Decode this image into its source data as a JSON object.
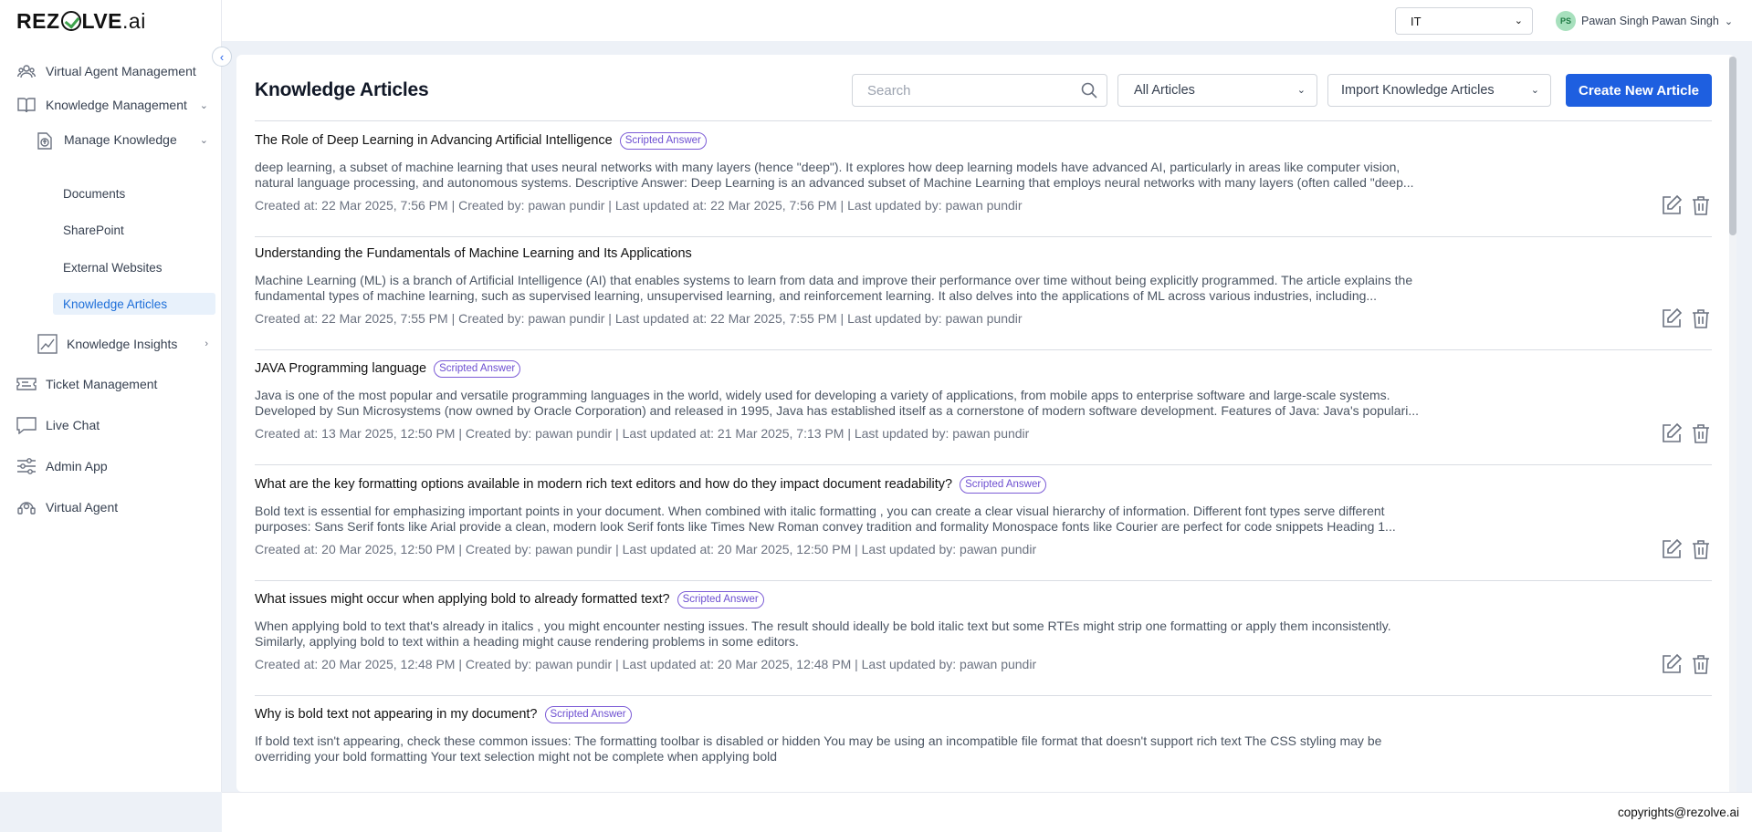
{
  "brand": {
    "logo_main": "REZ",
    "logo_rest": "LVE",
    "logo_suffix": ".ai"
  },
  "sidebar": {
    "items": [
      {
        "label": "Virtual Agent Management",
        "icon": "users-icon"
      },
      {
        "label": "Knowledge Management",
        "icon": "book-icon"
      },
      {
        "label": "Manage Knowledge",
        "icon": "doc-upload-icon"
      },
      {
        "label": "Documents"
      },
      {
        "label": "SharePoint"
      },
      {
        "label": "External Websites"
      },
      {
        "label": "Knowledge Articles"
      },
      {
        "label": "Knowledge Insights",
        "icon": "chart-icon"
      },
      {
        "label": "Ticket Management",
        "icon": "ticket-icon"
      },
      {
        "label": "Live Chat",
        "icon": "chat-icon"
      },
      {
        "label": "Admin App",
        "icon": "sliders-icon"
      },
      {
        "label": "Virtual Agent",
        "icon": "agent-icon"
      }
    ]
  },
  "topbar": {
    "department": "IT",
    "user_initials": "PS",
    "user_name": "Pawan Singh Pawan Singh"
  },
  "main": {
    "title": "Knowledge Articles",
    "search_placeholder": "Search",
    "filter_value": "All Articles",
    "import_label": "Import Knowledge Articles",
    "create_label": "Create New Article",
    "articles": [
      {
        "title": "The Role of Deep Learning in Advancing Artificial Intelligence",
        "badge": "Scripted Answer",
        "description": "deep learning, a subset of machine learning that uses neural networks with many layers (hence \"deep\"). It explores how deep learning models have advanced AI, particularly in areas like computer vision, natural language processing, and autonomous systems. Descriptive Answer: Deep Learning is an advanced subset of Machine Learning that employs neural networks with many layers (often called \"deep...",
        "meta": "Created at: 22 Mar 2025, 7:56 PM | Created by: pawan pundir | Last updated at: 22 Mar 2025, 7:56 PM | Last updated by: pawan pundir"
      },
      {
        "title": "Understanding the Fundamentals of Machine Learning and Its Applications",
        "badge": "",
        "description": "Machine Learning (ML) is a branch of Artificial Intelligence (AI) that enables systems to learn from data and improve their performance over time without being explicitly programmed. The article explains the fundamental types of machine learning, such as supervised learning, unsupervised learning, and reinforcement learning. It also delves into the applications of ML across various industries, including...",
        "meta": "Created at: 22 Mar 2025, 7:55 PM | Created by: pawan pundir | Last updated at: 22 Mar 2025, 7:55 PM | Last updated by: pawan pundir"
      },
      {
        "title": "JAVA Programming language",
        "badge": "Scripted Answer",
        "description": "Java is one of the most popular and versatile programming languages in the world, widely used for developing a variety of applications, from mobile apps to enterprise software and large-scale systems. Developed by Sun Microsystems (now owned by Oracle Corporation) and released in 1995, Java has established itself as a cornerstone of modern software development. Features of Java: Java's populari...",
        "meta": "Created at: 13 Mar 2025, 12:50 PM | Created by: pawan pundir | Last updated at: 21 Mar 2025, 7:13 PM | Last updated by: pawan pundir"
      },
      {
        "title": "What are the key formatting options available in modern rich text editors and how do they impact document readability?",
        "badge": "Scripted Answer",
        "description": "Bold text is essential for emphasizing important points in your document. When combined with italic formatting , you can create a clear visual hierarchy of information. Different font types serve different purposes: Sans Serif fonts like Arial provide a clean, modern look Serif fonts like Times New Roman convey tradition and formality Monospace fonts like Courier are perfect for code snippets Heading 1...",
        "meta": "Created at: 20 Mar 2025, 12:50 PM | Created by: pawan pundir | Last updated at: 20 Mar 2025, 12:50 PM | Last updated by: pawan pundir"
      },
      {
        "title": "What issues might occur when applying bold to already formatted text?",
        "badge": "Scripted Answer",
        "description": "When applying bold to text that's already in italics , you might encounter nesting issues. The result should ideally be bold italic text but some RTEs might strip one formatting or apply them inconsistently. Similarly, applying bold to text within a heading might cause rendering problems in some editors.",
        "meta": "Created at: 20 Mar 2025, 12:48 PM | Created by: pawan pundir | Last updated at: 20 Mar 2025, 12:48 PM | Last updated by: pawan pundir"
      },
      {
        "title": "Why is bold text not appearing in my document?",
        "badge": "Scripted Answer",
        "description": "If bold text isn't appearing, check these common issues: The formatting toolbar is disabled or hidden You may be using an incompatible file format that doesn't support rich text The CSS styling may be overriding your bold formatting Your text selection might not be complete when applying bold",
        "meta": ""
      }
    ]
  },
  "footer": {
    "copyright": "copyrights@rezolve.ai"
  },
  "colors": {
    "accent": "#1e5fe0",
    "badge": "#6d4fd1",
    "active_nav": "#1e6fd9"
  }
}
